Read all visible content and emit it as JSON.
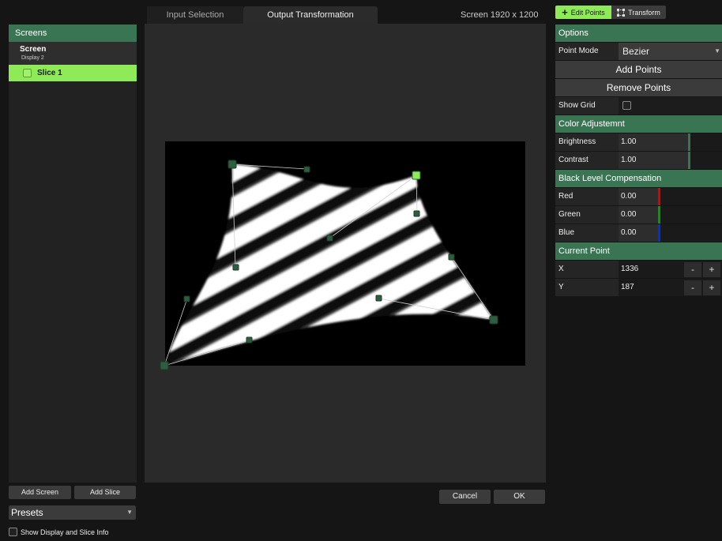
{
  "tabs": {
    "input_selection": "Input Selection",
    "output_transformation": "Output Transformation"
  },
  "screen_resolution": "Screen  1920 x 1200",
  "left": {
    "header": "Screens",
    "screen": {
      "name": "Screen",
      "display": "Display 2"
    },
    "slice": {
      "name": "Slice 1"
    },
    "add_screen": "Add Screen",
    "add_slice": "Add Slice",
    "presets": "Presets",
    "show_info": "Show Display and Slice Info"
  },
  "dialog": {
    "cancel": "Cancel",
    "ok": "OK"
  },
  "toolbar": {
    "edit_points": "Edit Points",
    "transform": "Transform"
  },
  "options": {
    "header": "Options",
    "point_mode_label": "Point Mode",
    "point_mode_value": "Bezier",
    "add_points": "Add Points",
    "remove_points": "Remove Points",
    "show_grid_label": "Show Grid"
  },
  "color_adjustment": {
    "header": "Color Adjustemnt",
    "brightness_label": "Brightness",
    "brightness_value": "1.00",
    "contrast_label": "Contrast",
    "contrast_value": "1.00"
  },
  "black_level": {
    "header": "Black Level Compensation",
    "red_label": "Red",
    "red_value": "0.00",
    "green_label": "Green",
    "green_value": "0.00",
    "blue_label": "Blue",
    "blue_value": "0.00"
  },
  "current_point": {
    "header": "Current Point",
    "x_label": "X",
    "x_value": "1336",
    "y_label": "Y",
    "y_value": "187",
    "minus": "-",
    "plus": "+"
  },
  "colors": {
    "accent": "#8fea57",
    "header_green": "#3a7553",
    "red": "#e00000",
    "green": "#00a000",
    "blue": "#0030e0"
  },
  "icons": {
    "edit_points": "plus-icon",
    "transform": "transform-icon",
    "dropdown": "chevron-down-icon"
  }
}
